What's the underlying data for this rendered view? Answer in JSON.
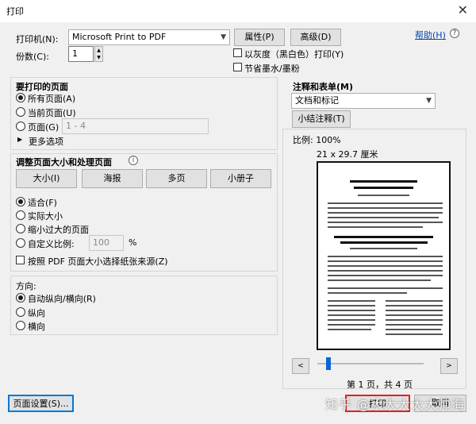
{
  "window": {
    "title": "打印",
    "close_glyph": "✕"
  },
  "printer": {
    "label": "打印机(N):",
    "selected": "Microsoft Print to PDF",
    "properties_button": "属性(P)",
    "advanced_button": "高级(D)",
    "help_link": "帮助(H)",
    "help_icon": "?"
  },
  "copies": {
    "label": "份数(C):",
    "value": "1"
  },
  "options": {
    "grayscale": "以灰度（黑白色）打印(Y)",
    "save_ink": "节省墨水/墨粉"
  },
  "pages": {
    "title": "要打印的页面",
    "all": "所有页面(A)",
    "current": "当前页面(U)",
    "range": "页面(G)",
    "range_value": "1 - 4",
    "more": "更多选项",
    "more_glyph": "▶"
  },
  "sizing": {
    "title": "调整页面大小和处理页面",
    "info_icon": "i",
    "size_button": "大小(I)",
    "poster_button": "海报",
    "multiple_button": "多页",
    "booklet_button": "小册子",
    "fit": "适合(F)",
    "actual": "实际大小",
    "shrink": "缩小过大的页面",
    "custom": "自定义比例:",
    "custom_value": "100",
    "percent": "%",
    "pdf_source": "按照 PDF 页面大小选择纸张来源(Z)"
  },
  "orientation": {
    "title": "方向:",
    "auto": "自动纵向/横向(R)",
    "portrait": "纵向",
    "landscape": "横向"
  },
  "comments": {
    "title": "注释和表单(M)",
    "selected": "文档和标记",
    "summarize_button": "小结注释(T)"
  },
  "preview": {
    "scale": "比例: 100%",
    "paper": "21 x 29.7 厘米",
    "page_indicator": "第 1 页，共 4 页",
    "prev_glyph": "<",
    "next_glyph": ">"
  },
  "footer": {
    "page_setup_button": "页面设置(S)...",
    "print_button": "打印",
    "cancel_button": "取消",
    "watermark": "知乎 @大大大大大帅海"
  }
}
